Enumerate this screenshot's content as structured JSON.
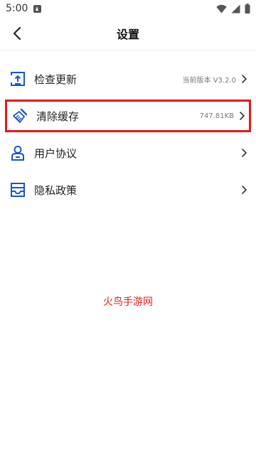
{
  "status_bar": {
    "time": "5:00"
  },
  "header": {
    "title": "设置"
  },
  "menu": [
    {
      "label": "检查更新",
      "value": "当前版本 V3.2.0",
      "icon": "upload-icon"
    },
    {
      "label": "清除缓存",
      "value": "747.81KB",
      "icon": "broom-icon"
    },
    {
      "label": "用户协议",
      "value": "",
      "icon": "user-icon"
    },
    {
      "label": "隐私政策",
      "value": "",
      "icon": "inbox-icon"
    }
  ],
  "watermark": "火鸟手游网",
  "colors": {
    "accent": "#1a56c9",
    "highlight_border": "#e01919",
    "watermark": "#e0211b"
  }
}
